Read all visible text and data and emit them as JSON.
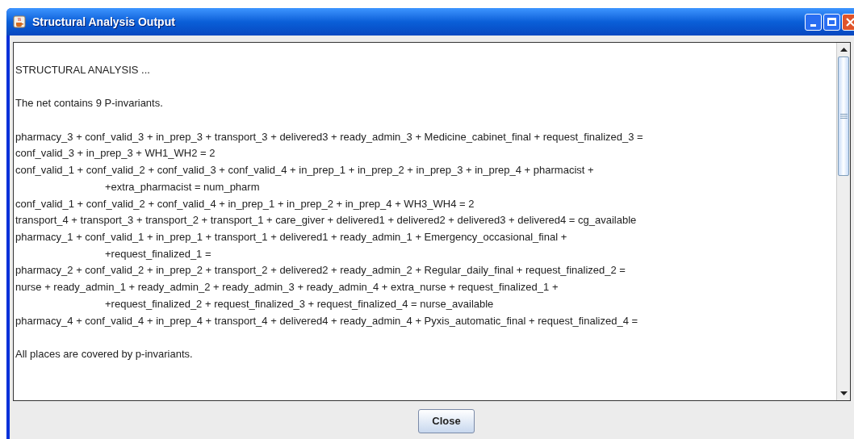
{
  "window": {
    "title": "Structural Analysis Output"
  },
  "output": {
    "paragraphs": [
      [
        {
          "text": "STRUCTURAL ANALYSIS ..."
        }
      ],
      [
        {
          "text": "The net contains 9 P-invariants."
        }
      ],
      [
        {
          "text": "pharmacy_3 + conf_valid_3 + in_prep_3 + transport_3 + delivered3 + ready_admin_3 + Medicine_cabinet_final + request_finalized_3 ="
        },
        {
          "text": "conf_valid_3 + in_prep_3 + WH1_WH2 = 2"
        },
        {
          "text": "conf_valid_1 + conf_valid_2 + conf_valid_3 + conf_valid_4 + in_prep_1 + in_prep_2 + in_prep_3 + in_prep_4 + pharmacist +",
          "children": [
            {
              "text": "+extra_pharmacist = num_pharm"
            }
          ]
        },
        {
          "text": "conf_valid_1 + conf_valid_2 + conf_valid_4 + in_prep_1 + in_prep_2 + in_prep_4 + WH3_WH4 = 2"
        },
        {
          "text": "transport_4 + transport_3 + transport_2 + transport_1 + care_giver + delivered1 + delivered2 + delivered3 + delivered4 = cg_available"
        },
        {
          "text": "pharmacy_1 + conf_valid_1 + in_prep_1 + transport_1 + delivered1 + ready_admin_1 + Emergency_occasional_final +",
          "children": [
            {
              "text": "+request_finalized_1 ="
            }
          ]
        },
        {
          "text": "pharmacy_2 + conf_valid_2 + in_prep_2 + transport_2 + delivered2 + ready_admin_2 + Regular_daily_final + request_finalized_2 ="
        },
        {
          "text": "nurse + ready_admin_1 + ready_admin_2 + ready_admin_3 + ready_admin_4 + extra_nurse + request_finalized_1 +",
          "children": [
            {
              "text": "+request_finalized_2 + request_finalized_3 + request_finalized_4 = nurse_available"
            }
          ]
        },
        {
          "text": "pharmacy_4 + conf_valid_4 + in_prep_4 + transport_4 + delivered4 + ready_admin_4 + Pyxis_automatic_final + request_finalized_4 ="
        }
      ],
      [
        {
          "text": "All places are covered by p-invariants."
        }
      ]
    ]
  },
  "buttons": [
    "Close"
  ]
}
